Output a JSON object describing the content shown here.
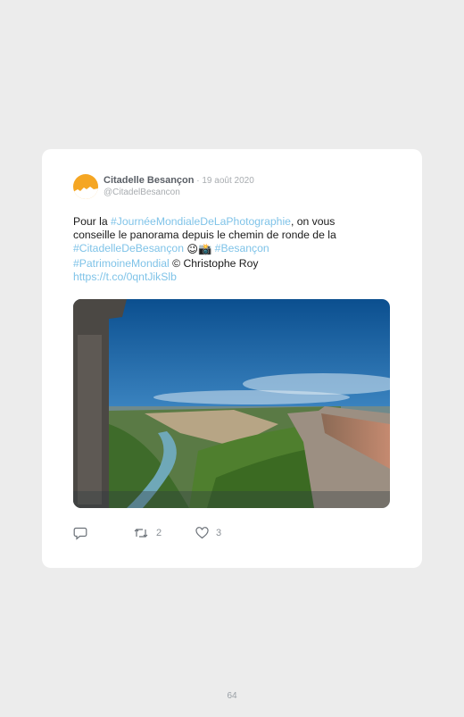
{
  "tweet": {
    "author_name": "Citadelle Besançon",
    "separator": " · ",
    "date": "19 août 2020",
    "handle": "@CitadelBesancon",
    "text": {
      "part1": "Pour la ",
      "hashtag1": "#JournéeMondialeDeLaPhotographie",
      "part2": ", on vous conseille le panorama depuis le chemin de ronde de la ",
      "hashtag2": "#CitadelleDeBesançon",
      "emojis": "😉📸",
      "hashtag3": "#Besançon",
      "hashtag4": "#PatrimoineMondial",
      "credit": "© Christophe Roy",
      "url": "https://t.co/0qntJikSlb"
    },
    "actions": {
      "reply_icon": "reply-icon",
      "retweet_icon": "retweet-icon",
      "like_icon": "heart-icon",
      "retweet_count": "2",
      "like_count": "3"
    }
  },
  "page": {
    "number": "64"
  },
  "colors": {
    "link": "#7fc3e8",
    "name": "#5a5f66",
    "meta": "#a8acb0",
    "background": "#ececec",
    "card": "#ffffff"
  }
}
